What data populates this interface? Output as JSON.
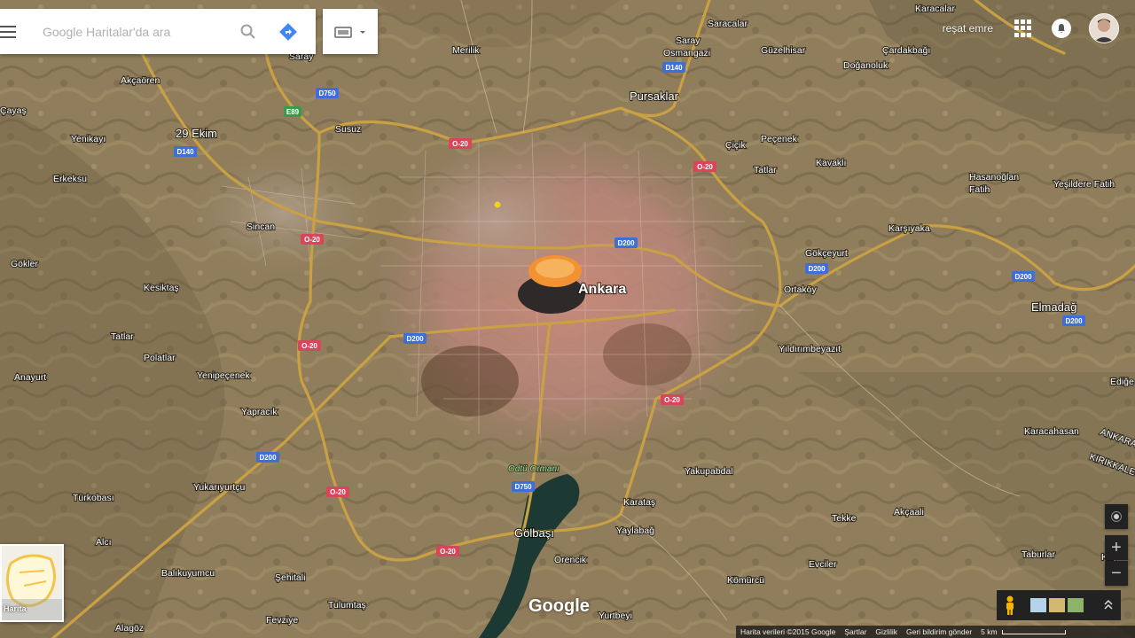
{
  "search": {
    "placeholder": "Google Haritalar'da ara"
  },
  "account": {
    "username": "reşat emre"
  },
  "places": {
    "ankara": "Ankara",
    "pursaklar": "Pursaklar",
    "golbasi": "Gölbaşı",
    "elmadag": "Elmadağ",
    "saray": "Saray",
    "osmangazi": "Osmangazi",
    "saracalar": "Saracalar",
    "guzelhisar": "Güzelhisar",
    "karacalar": "Karacalar",
    "cardakbagi": "Çardakbağı",
    "doganoluk": "Doğanoluk",
    "merilik": "Merilik",
    "susuz": "Susuz",
    "ekim29": "29 Ekim",
    "akcaoren": "Akçaören",
    "yenikayi": "Yenikayı",
    "erkeksu": "Erkeksu",
    "sincan": "Sincan",
    "gokler": "Gökler",
    "kesiktas": "Kesiktaş",
    "tatlar1": "Tatlar",
    "polatlar": "Polatlar",
    "anayurt": "Anayurt",
    "yenipecenek": "Yenipeçenek",
    "yapracik": "Yapracık",
    "yukariyurtcu": "Yukarıyurtçu",
    "turkobasi": "Türkobası",
    "alci": "Alcı",
    "balikuyumcu": "Balıkuyumcu",
    "sehitali": "Şehitali",
    "tulumtas": "Tulumtaş",
    "fevziye": "Fevziye",
    "alagoz": "Alagöz",
    "orencik": "Örencik",
    "yurtbeyi": "Yurtbeyi",
    "komurcu": "Kömürcü",
    "yaylabag": "Yaylabağ",
    "karatas": "Karataş",
    "yakupabdal": "Yakupabdal",
    "evciler": "Evciler",
    "tekke": "Tekke",
    "akcaali": "Akçaali",
    "taburlar": "Taburlar",
    "karacahasan": "Karacahasan",
    "yildirimbeyazit": "Yıldırımbeyazıt",
    "ortakoy": "Ortaköy",
    "gokceyurt": "Gökçeyurt",
    "kariyaka": "Karşıyaka",
    "hasanoglan": "Hasanoğlan",
    "fatih1": "Fatih",
    "yesildere": "Yeşildere Fatih",
    "kavaklı": "Kavaklı",
    "pecenek": "Peçenek",
    "cicik": "Çiçik",
    "tatlar2": "Tatlar",
    "edige": "Ediğe",
    "ankara_edge": "ANKARA",
    "kirikkale_edge": "KIRIKKALE",
    "kuy": "Kuy",
    "odtu": "Odtü Ormanı",
    "cayas": "Çayaş"
  },
  "road_shields": {
    "o20": "O-20",
    "d200": "D200",
    "d140": "D140",
    "d750": "D750",
    "e89": "E89"
  },
  "layer_toggle": {
    "label": "Harita"
  },
  "attribution": {
    "data": "Harita verileri ©2015 Google",
    "terms": "Şartlar",
    "privacy": "Gizlilik",
    "feedback": "Geri bildirim gönder",
    "scale": "5 km"
  },
  "logo": "Google",
  "colors": {
    "highway": "#c9a043",
    "shield_red": "#d9455a",
    "shield_blue": "#3d6fd6",
    "shield_green": "#3a9a4a",
    "directions_blue": "#4285f4"
  }
}
